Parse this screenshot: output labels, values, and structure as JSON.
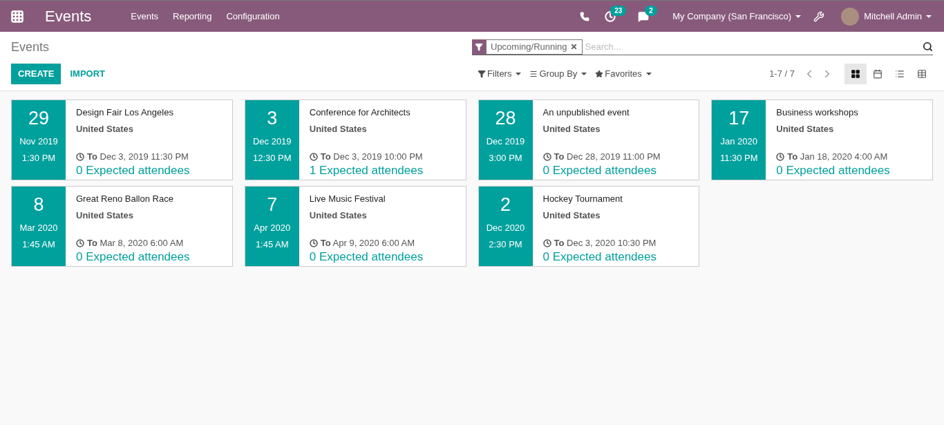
{
  "navbar": {
    "app_title": "Events",
    "menu": [
      "Events",
      "Reporting",
      "Configuration"
    ],
    "activity_count": "23",
    "message_count": "2",
    "company": "My Company (San Francisco)",
    "user": "Mitchell Admin"
  },
  "control_panel": {
    "breadcrumb": "Events",
    "buttons": [
      "CREATE",
      "IMPORT"
    ],
    "search": {
      "facet": "Upcoming/Running",
      "placeholder": "Search..."
    },
    "filters": [
      "Filters",
      "Group By",
      "Favorites"
    ],
    "pager": "1-7 / 7",
    "views": [
      {
        "kind": "kanban",
        "selected": true
      },
      {
        "kind": "calendar",
        "selected": false
      },
      {
        "kind": "list",
        "selected": false
      },
      {
        "kind": "pivot",
        "selected": false
      }
    ]
  },
  "events": [
    {
      "day": "29",
      "month": "Nov 2019",
      "time": "1:30 PM",
      "name": "Design Fair Los Angeles",
      "country": "United States",
      "end": "**To** Dec 3, 2019 11:30 PM",
      "attendees": "0 Expected attendees"
    },
    {
      "day": "3",
      "month": "Dec 2019",
      "time": "12:30 PM",
      "name": "Conference for Architects",
      "country": "United States",
      "end": "**To** Dec 3, 2019 10:00 PM",
      "attendees": "1 Expected attendees"
    },
    {
      "day": "28",
      "month": "Dec 2019",
      "time": "3:00 PM",
      "name": "An unpublished event",
      "country": "United States",
      "end": "**To** Dec 28, 2019 11:00 PM",
      "attendees": "0 Expected attendees"
    },
    {
      "day": "17",
      "month": "Jan 2020",
      "time": "11:30 PM",
      "name": "Business workshops",
      "country": "United States",
      "end": "**To** Jan 18, 2020 4:00 AM",
      "attendees": "0 Expected attendees"
    },
    {
      "day": "8",
      "month": "Mar 2020",
      "time": "1:45 AM",
      "name": "Great Reno Ballon Race",
      "country": "United States",
      "end": "**To** Mar 8, 2020 6:00 AM",
      "attendees": "0 Expected attendees"
    },
    {
      "day": "7",
      "month": "Apr 2020",
      "time": "1:45 AM",
      "name": "Live Music Festival",
      "country": "United States",
      "end": "**To** Apr 9, 2020 6:00 AM",
      "attendees": "0 Expected attendees"
    },
    {
      "day": "2",
      "month": "Dec 2020",
      "time": "2:30 PM",
      "name": "Hockey Tournament",
      "country": "United States",
      "end": "**To** Dec 3, 2020 10:30 PM",
      "attendees": "0 Expected attendees"
    }
  ]
}
